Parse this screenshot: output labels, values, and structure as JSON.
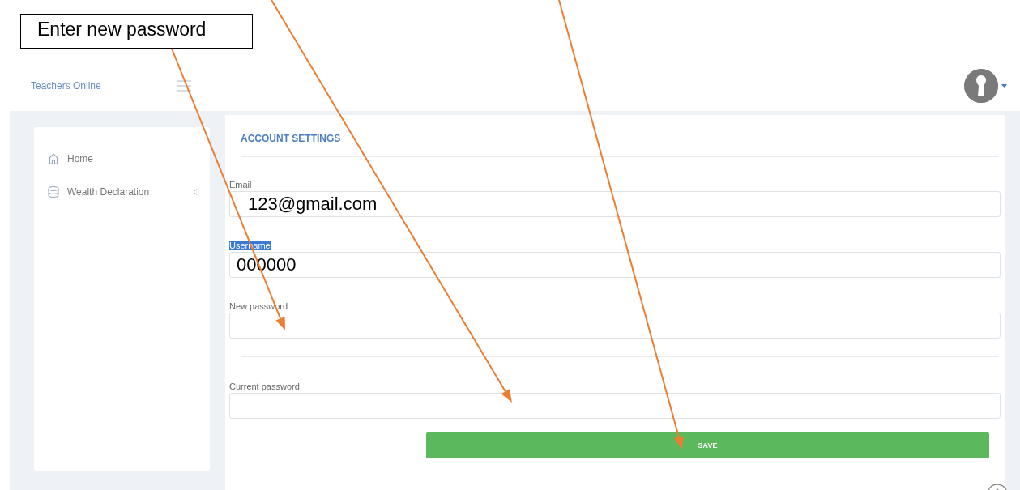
{
  "callout": {
    "text": "Enter new password"
  },
  "header": {
    "brand": "Teachers Online"
  },
  "sidebar": {
    "items": [
      {
        "label": "Home",
        "kind": "link"
      },
      {
        "label": "Wealth Declaration",
        "kind": "submenu"
      }
    ]
  },
  "settings": {
    "title": "ACCOUNT SETTINGS",
    "fields": [
      {
        "label": "Email",
        "value": "123@gmail.com",
        "label_highlighted": false,
        "divider_before": false
      },
      {
        "label": "Username",
        "value": "000000",
        "label_highlighted": true,
        "divider_before": false
      },
      {
        "label": "New password",
        "label_highlighted": false,
        "divider_before": false
      },
      {
        "label": "Current password",
        "label_highlighted": false,
        "divider_before": true
      }
    ],
    "save_button": "SAVE"
  }
}
